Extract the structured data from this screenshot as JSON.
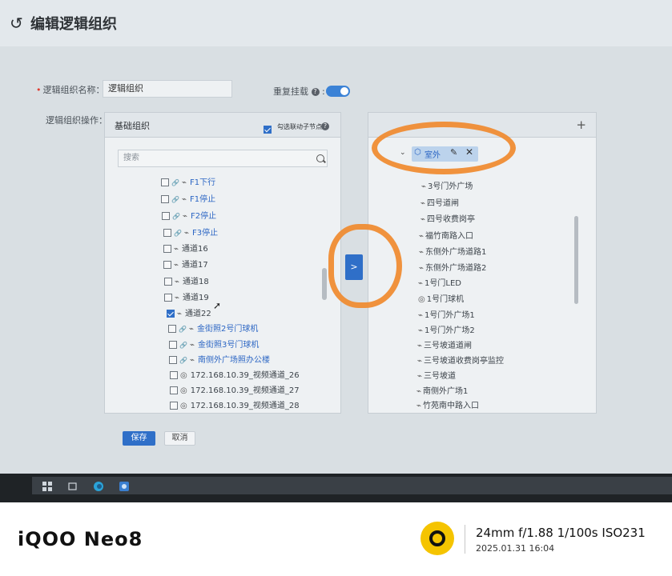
{
  "page": {
    "title": "编辑逻辑组织"
  },
  "form": {
    "name_label": "逻辑组织名称：",
    "name_value": "逻辑组织",
    "repeat_label": "重复挂载",
    "operation_label": "逻辑组织操作："
  },
  "left_panel": {
    "title": "基础组织",
    "linkage_label": "勾选联动子节点",
    "search_placeholder": "搜索",
    "items": [
      {
        "label": "F1下行",
        "checked": false,
        "color": "blue"
      },
      {
        "label": "F1停止",
        "checked": false,
        "color": "blue"
      },
      {
        "label": "F2停止",
        "checked": false,
        "color": "blue"
      },
      {
        "label": "F3停止",
        "checked": false,
        "color": "blue"
      },
      {
        "label": "通道16",
        "checked": false,
        "color": "dark"
      },
      {
        "label": "通道17",
        "checked": false,
        "color": "dark"
      },
      {
        "label": "通道18",
        "checked": false,
        "color": "dark"
      },
      {
        "label": "通道19",
        "checked": false,
        "color": "dark"
      },
      {
        "label": "通道22",
        "checked": true,
        "color": "dark"
      },
      {
        "label": "金街照2号门球机",
        "checked": false,
        "color": "blue"
      },
      {
        "label": "金街照3号门球机",
        "checked": false,
        "color": "blue"
      },
      {
        "label": "南侧外广场照办公楼",
        "checked": false,
        "color": "blue"
      },
      {
        "label": "172.168.10.39_视频通道_26",
        "checked": false,
        "color": "dark"
      },
      {
        "label": "172.168.10.39_视频通道_27",
        "checked": false,
        "color": "dark"
      },
      {
        "label": "172.168.10.39_视频通道_28",
        "checked": false,
        "color": "dark"
      }
    ]
  },
  "transfer_button": ">",
  "right_panel": {
    "add_label": "+",
    "selected_node": "室外",
    "items": [
      "3号门外广场",
      "四号道闸",
      "四号收费岗亭",
      "福竹南路入口",
      "东侧外广场道路1",
      "东侧外广场道路2",
      "1号门LED",
      "1号门球机",
      "1号门外广场1",
      "1号门外广场2",
      "三号坡道道闸",
      "三号坡道收费岗亭监控",
      "三号坡道",
      "南侧外广场1",
      "竹苑南中路入口"
    ]
  },
  "buttons": {
    "save": "保存",
    "cancel": "取消"
  },
  "watermark": {
    "brand": "iQOO Neo8",
    "specs": "24mm  f/1.88  1/100s  ISO231",
    "date": "2025.01.31 16:04"
  },
  "colors": {
    "accent": "#2f6fc8",
    "annotation": "#f08a2e",
    "logo": "#f5c400"
  }
}
